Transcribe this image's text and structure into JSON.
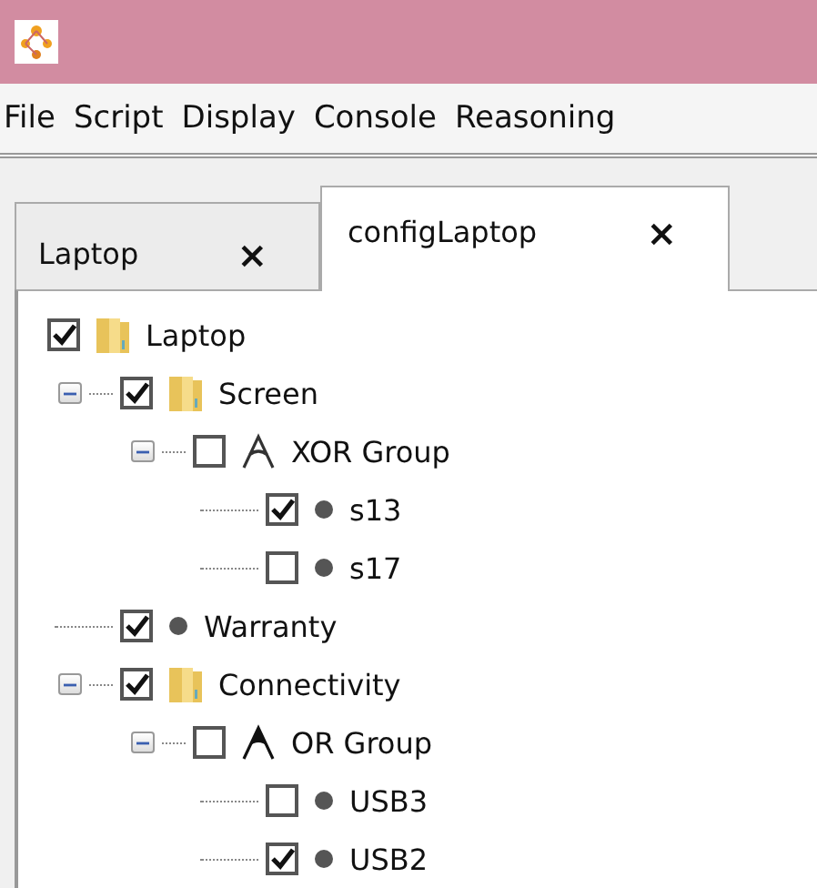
{
  "menu": [
    "File",
    "Script",
    "Display",
    "Console",
    "Reasoning"
  ],
  "tabs": [
    {
      "label": "Laptop",
      "close": "×",
      "selected": false
    },
    {
      "label": "configLaptop",
      "close": "×",
      "selected": true
    }
  ],
  "tree": [
    {
      "label": "Laptop",
      "kind": "folder",
      "checked": true,
      "children": [
        {
          "label": "Screen",
          "kind": "folder",
          "checked": true,
          "expanded": true,
          "children": [
            {
              "label": "XOR Group",
              "kind": "xor",
              "checked": false,
              "expanded": true,
              "children": [
                {
                  "label": "s13",
                  "kind": "feature",
                  "checked": true
                },
                {
                  "label": "s17",
                  "kind": "feature",
                  "checked": false
                }
              ]
            }
          ]
        },
        {
          "label": "Warranty",
          "kind": "feature",
          "checked": true
        },
        {
          "label": "Connectivity",
          "kind": "folder",
          "checked": true,
          "expanded": true,
          "children": [
            {
              "label": "OR Group",
              "kind": "or",
              "checked": false,
              "expanded": true,
              "children": [
                {
                  "label": "USB3",
                  "kind": "feature",
                  "checked": false
                },
                {
                  "label": "USB2",
                  "kind": "feature",
                  "checked": true
                }
              ]
            }
          ]
        }
      ]
    }
  ]
}
